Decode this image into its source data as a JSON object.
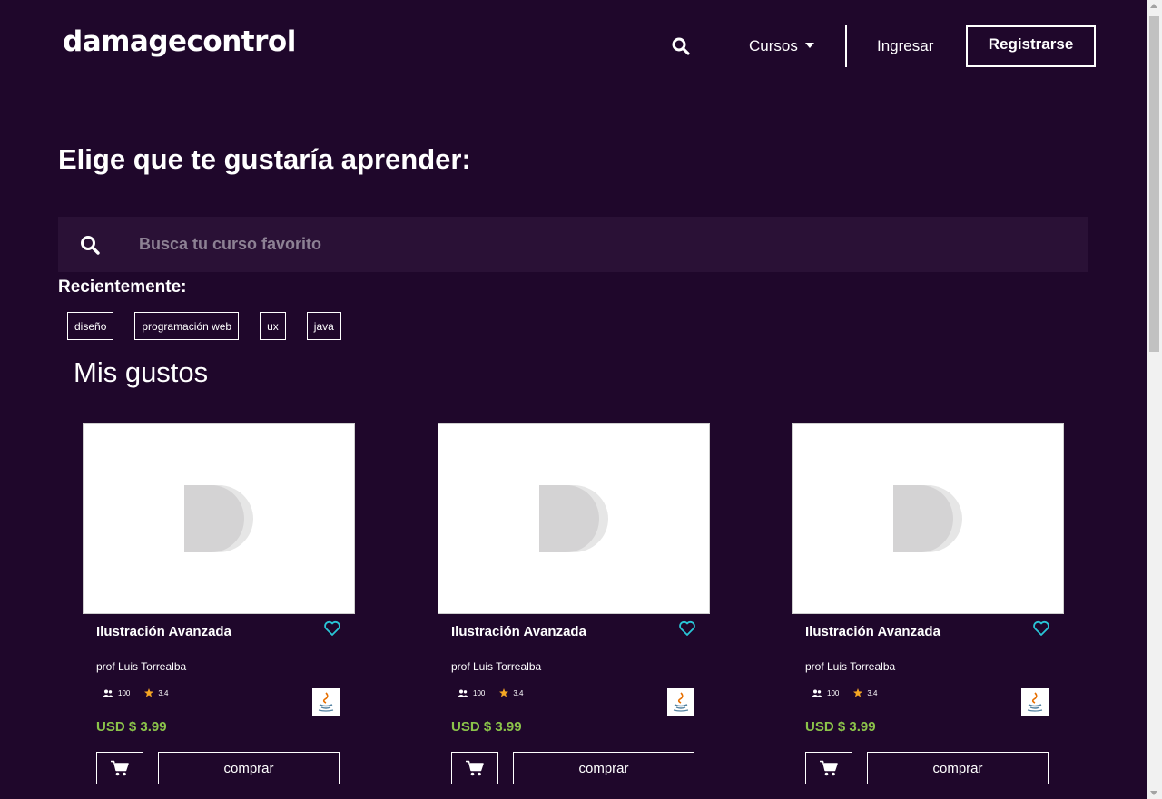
{
  "header": {
    "logo": "damagecontrol",
    "courses_label": "Cursos",
    "login_label": "Ingresar",
    "register_label": "Registrarse",
    "search_icon": "search-icon"
  },
  "main": {
    "title": "Elige que te gustaría aprender:",
    "search": {
      "placeholder": "Busca tu curso favorito",
      "value": ""
    },
    "recent_label": "Recientemente:",
    "recent_tags": [
      "diseño",
      "programación web",
      "ux",
      "java"
    ],
    "section_title": "Mis gustos"
  },
  "colors": {
    "background": "#1f072b",
    "search_background": "#2a1136",
    "price": "#8bc34a",
    "heart": "#29c5d6",
    "star": "#f5a623"
  },
  "cards": [
    {
      "title": "Ilustración Avanzada",
      "author": "prof Luis Torrealba",
      "students": "100",
      "rating": "3.4",
      "price": "USD $ 3.99",
      "buy_label": "comprar"
    },
    {
      "title": "Ilustración Avanzada",
      "author": "prof Luis Torrealba",
      "students": "100",
      "rating": "3.4",
      "price": "USD $ 3.99",
      "buy_label": "comprar"
    },
    {
      "title": "Ilustración Avanzada",
      "author": "prof Luis Torrealba",
      "students": "100",
      "rating": "3.4",
      "price": "USD $ 3.99",
      "buy_label": "comprar"
    }
  ]
}
